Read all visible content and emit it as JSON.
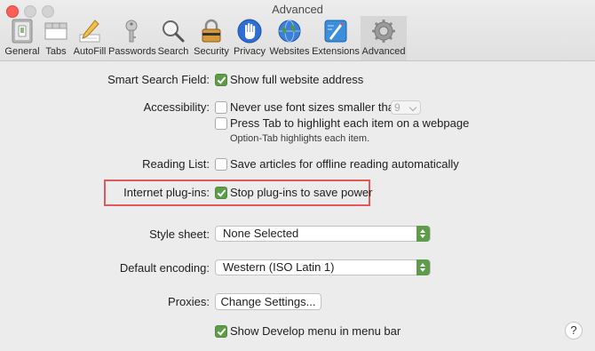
{
  "window": {
    "title": "Advanced",
    "colors": {
      "accent_green": "#5e9c4a",
      "highlight_red": "#e2595b",
      "close": "#fe5f57"
    }
  },
  "toolbar": {
    "tabs": [
      {
        "label": "General",
        "icon": "switch-icon"
      },
      {
        "label": "Tabs",
        "icon": "tabs-icon"
      },
      {
        "label": "AutoFill",
        "icon": "pencil-icon"
      },
      {
        "label": "Passwords",
        "icon": "key-icon"
      },
      {
        "label": "Search",
        "icon": "magnifier-icon"
      },
      {
        "label": "Security",
        "icon": "lock-icon"
      },
      {
        "label": "Privacy",
        "icon": "hand-icon"
      },
      {
        "label": "Websites",
        "icon": "globe-icon"
      },
      {
        "label": "Extensions",
        "icon": "puzzle-icon"
      },
      {
        "label": "Advanced",
        "icon": "gear-icon"
      }
    ],
    "selected": "Advanced"
  },
  "settings": {
    "smart_search": {
      "label": "Smart Search Field:",
      "option": "Show full website address",
      "checked": true
    },
    "accessibility": {
      "label": "Accessibility:",
      "font_option": "Never use font sizes smaller than",
      "font_size": "9",
      "tab_option": "Press Tab to highlight each item on a webpage",
      "tab_hint": "Option-Tab highlights each item."
    },
    "reading_list": {
      "label": "Reading List:",
      "option": "Save articles for offline reading automatically"
    },
    "plugins": {
      "label": "Internet plug-ins:",
      "option": "Stop plug-ins to save power",
      "checked": true
    },
    "style_sheet": {
      "label": "Style sheet:",
      "value": "None Selected"
    },
    "encoding": {
      "label": "Default encoding:",
      "value": "Western (ISO Latin 1)"
    },
    "proxies": {
      "label": "Proxies:",
      "button": "Change Settings..."
    },
    "develop": {
      "option": "Show Develop menu in menu bar",
      "checked": true
    }
  },
  "help": {
    "label": "?"
  }
}
